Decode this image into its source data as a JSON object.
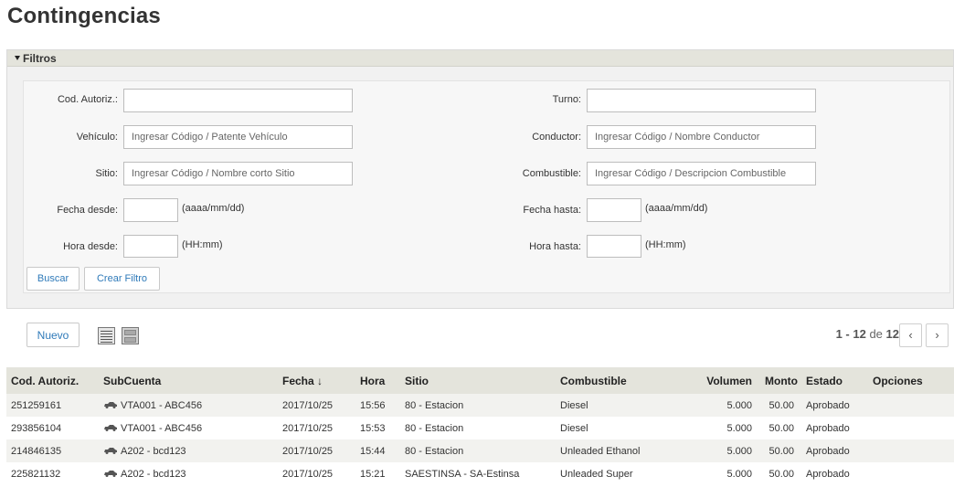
{
  "page": {
    "title": "Contingencias"
  },
  "filters": {
    "header": "Filtros",
    "fields": {
      "cod_autoriz": {
        "label": "Cod. Autoriz.:",
        "value": "",
        "placeholder": ""
      },
      "turno": {
        "label": "Turno:",
        "value": "",
        "placeholder": ""
      },
      "vehiculo": {
        "label": "Vehículo:",
        "placeholder": "Ingresar Código / Patente Vehículo"
      },
      "conductor": {
        "label": "Conductor:",
        "placeholder": "Ingresar Código / Nombre Conductor"
      },
      "sitio": {
        "label": "Sitio:",
        "placeholder": "Ingresar Código / Nombre corto Sitio"
      },
      "combustible": {
        "label": "Combustible:",
        "placeholder": "Ingresar Código / Descripcion Combustible"
      },
      "fecha_desde": {
        "label": "Fecha desde:",
        "hint": "(aaaa/mm/dd)"
      },
      "fecha_hasta": {
        "label": "Fecha hasta:",
        "hint": "(aaaa/mm/dd)"
      },
      "hora_desde": {
        "label": "Hora desde:",
        "hint": "(HH:mm)"
      },
      "hora_hasta": {
        "label": "Hora hasta:",
        "hint": "(HH:mm)"
      }
    },
    "buttons": {
      "buscar": "Buscar",
      "crear_filtro": "Crear Filtro"
    }
  },
  "toolbar": {
    "nuevo_label": "Nuevo",
    "icons": [
      "list-view-icon",
      "grid-view-icon"
    ]
  },
  "pagination": {
    "range": "1 - 12",
    "of": "de",
    "total": "12",
    "prev": "‹",
    "next": "›"
  },
  "table": {
    "headers": [
      "Cod. Autoriz.",
      "SubCuenta",
      "Fecha ↓",
      "Hora",
      "Sitio",
      "Combustible",
      "Volumen",
      "Monto",
      "Estado",
      "Opciones"
    ],
    "rows": [
      {
        "cod": "251259161",
        "subcuenta": "VTA001 - ABC456",
        "fecha": "2017/10/25",
        "hora": "15:56",
        "sitio": "80 - Estacion",
        "combustible": "Diesel",
        "volumen": "5.000",
        "monto": "50.00",
        "estado": "Aprobado"
      },
      {
        "cod": "293856104",
        "subcuenta": "VTA001 - ABC456",
        "fecha": "2017/10/25",
        "hora": "15:53",
        "sitio": "80 - Estacion",
        "combustible": "Diesel",
        "volumen": "5.000",
        "monto": "50.00",
        "estado": "Aprobado"
      },
      {
        "cod": "214846135",
        "subcuenta": "A202 - bcd123",
        "fecha": "2017/10/25",
        "hora": "15:44",
        "sitio": "80 - Estacion",
        "combustible": "Unleaded Ethanol",
        "volumen": "5.000",
        "monto": "50.00",
        "estado": "Aprobado"
      },
      {
        "cod": "225821132",
        "subcuenta": "A202 - bcd123",
        "fecha": "2017/10/25",
        "hora": "15:21",
        "sitio": "SAESTINSA - SA-Estinsa",
        "combustible": "Unleaded Super",
        "volumen": "5.000",
        "monto": "50.00",
        "estado": "Aprobado"
      }
    ]
  },
  "colors": {
    "accent": "#2f7ab9",
    "header_bg": "#e4e4dc",
    "panel_bg": "#f1f1f1"
  }
}
